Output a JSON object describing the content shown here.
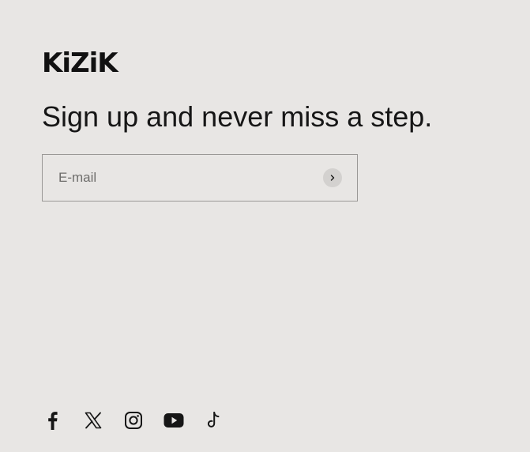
{
  "brand": {
    "logo_text": "KiZiK"
  },
  "newsletter": {
    "headline": "Sign up and never miss a step.",
    "email_placeholder": "E-mail",
    "submit_icon": "chevron-right-icon"
  },
  "social": {
    "items": [
      {
        "name": "Facebook",
        "icon": "facebook-icon"
      },
      {
        "name": "X",
        "icon": "x-icon"
      },
      {
        "name": "Instagram",
        "icon": "instagram-icon"
      },
      {
        "name": "YouTube",
        "icon": "youtube-icon"
      },
      {
        "name": "TikTok",
        "icon": "tiktok-icon"
      }
    ]
  },
  "colors": {
    "background": "#e8e6e4",
    "text": "#161616",
    "input_border": "#9a9896",
    "submit_circle": "#d3d1cf"
  }
}
